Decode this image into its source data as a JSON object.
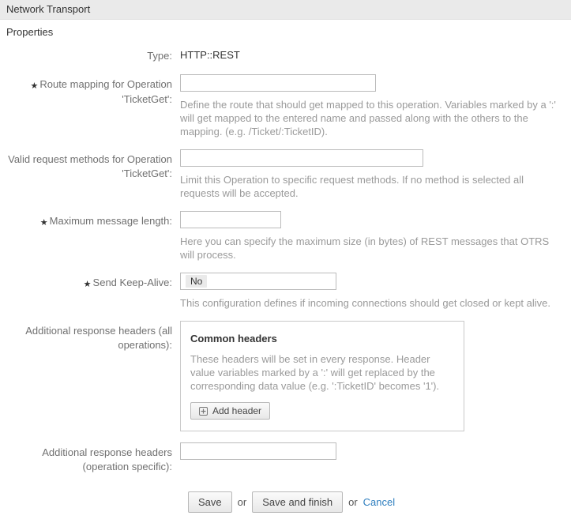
{
  "header": {
    "title": "Network Transport"
  },
  "section": {
    "title": "Properties"
  },
  "fields": {
    "type": {
      "label": "Type:",
      "value": "HTTP::REST"
    },
    "route": {
      "label": "Route mapping for Operation 'TicketGet':",
      "value": "",
      "help": "Define the route that should get mapped to this operation. Variables marked by a ':' will get mapped to the entered name and passed along with the others to the mapping. (e.g. /Ticket/:TicketID)."
    },
    "methods": {
      "label": "Valid request methods for Operation 'TicketGet':",
      "value": "",
      "help": "Limit this Operation to specific request methods. If no method is selected all requests will be accepted."
    },
    "maxlen": {
      "label": "Maximum message length:",
      "value": "",
      "help": "Here you can specify the maximum size (in bytes) of REST messages that OTRS will process."
    },
    "keepalive": {
      "label": "Send Keep-Alive:",
      "value": "No",
      "help": "This configuration defines if incoming connections should get closed or kept alive."
    },
    "headers_all": {
      "label": "Additional response headers (all operations):",
      "panel_title": "Common headers",
      "panel_desc": "These headers will be set in every response. Header value variables marked by a ':' will get replaced by the corresponding data value (e.g. ':TicketID' becomes '1').",
      "add_button": "Add header"
    },
    "headers_op": {
      "label": "Additional response headers (operation specific):",
      "value": ""
    }
  },
  "actions": {
    "save": "Save",
    "or1": "or",
    "save_finish": "Save and finish",
    "or2": "or",
    "cancel": "Cancel"
  }
}
